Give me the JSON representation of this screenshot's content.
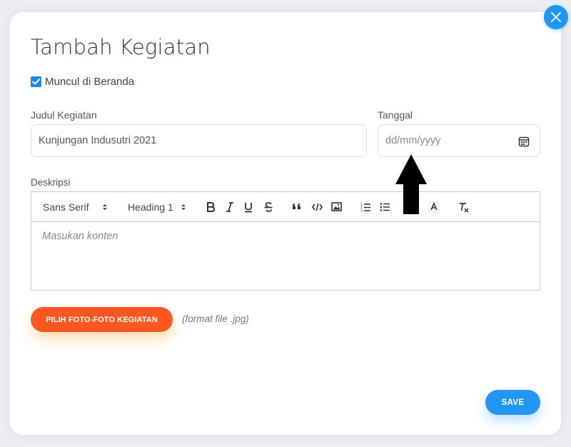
{
  "modal": {
    "title": "Tambah Kegiatan",
    "show_on_home": {
      "label": "Muncul di Beranda",
      "checked": true
    }
  },
  "fields": {
    "title_label": "Judul Kegiatan",
    "title_value": "Kunjungan Indusutri 2021",
    "date_label": "Tanggal",
    "date_placeholder": "dd/mm/yyyy",
    "description_label": "Deskripsi"
  },
  "editor": {
    "font_select": "Sans Serif",
    "heading_select": "Heading 1",
    "placeholder": "Masukan konten",
    "tools": [
      "bold-icon",
      "italic-icon",
      "underline-icon",
      "strikethrough-icon",
      "blockquote-icon",
      "code-block-icon",
      "image-icon",
      "ordered-list-icon",
      "bullet-list-icon",
      "text-background-icon",
      "clear-format-icon"
    ]
  },
  "upload": {
    "button_label": "PILIH FOTO-FOTO KEGIATAN",
    "format_note": "(format file .jpg)"
  },
  "actions": {
    "save_label": "SAVE"
  },
  "colors": {
    "primary": "#2196f3",
    "accent": "#ff5722",
    "checkbox": "#1e88e5"
  }
}
